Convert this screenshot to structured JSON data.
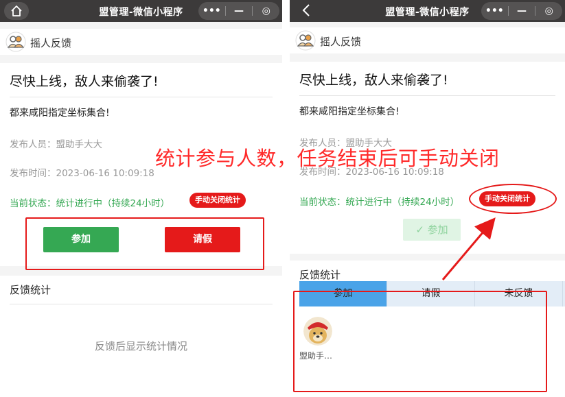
{
  "window": {
    "title": "盟管理-微信小程序",
    "capsule": {
      "more": "•••",
      "minimize": "—",
      "close": "◎"
    },
    "home_icon": "home-icon",
    "back_icon": "back-chevron-icon"
  },
  "page": {
    "nav_title": "摇人反馈",
    "nav_icon": "group-people-icon"
  },
  "notice": {
    "title": "尽快上线，敌人来偷袭了!",
    "body": "都来咸阳指定坐标集合!",
    "publisher_label": "发布人员：",
    "publisher": "盟助手大大",
    "time_label": "发布时间：",
    "time": "2023-06-16 10:09:18",
    "status_label": "当前状态：",
    "status": "统计进行中（持续24小时）",
    "close_stat_button": "手动关闭统计"
  },
  "actions": {
    "join_button": "参加",
    "leave_button": "请假",
    "joined_button": "参加",
    "joined_icon": "check-icon"
  },
  "stats": {
    "title": "反馈统计",
    "empty_text": "反馈后显示统计情况",
    "tabs": [
      "参加",
      "请假",
      "未反馈"
    ],
    "active_tab": "参加",
    "members": [
      {
        "name": "盟助手…",
        "avatar_icon": "doge-avatar"
      }
    ]
  },
  "annotation": {
    "text": "统计参与人数，任务结束后可手动关闭",
    "color": "#ff2a2a"
  },
  "colors": {
    "titlebar": "#3c3a3a",
    "green": "#35a853",
    "red": "#e51a1a",
    "tab_active": "#4aa3e8"
  }
}
